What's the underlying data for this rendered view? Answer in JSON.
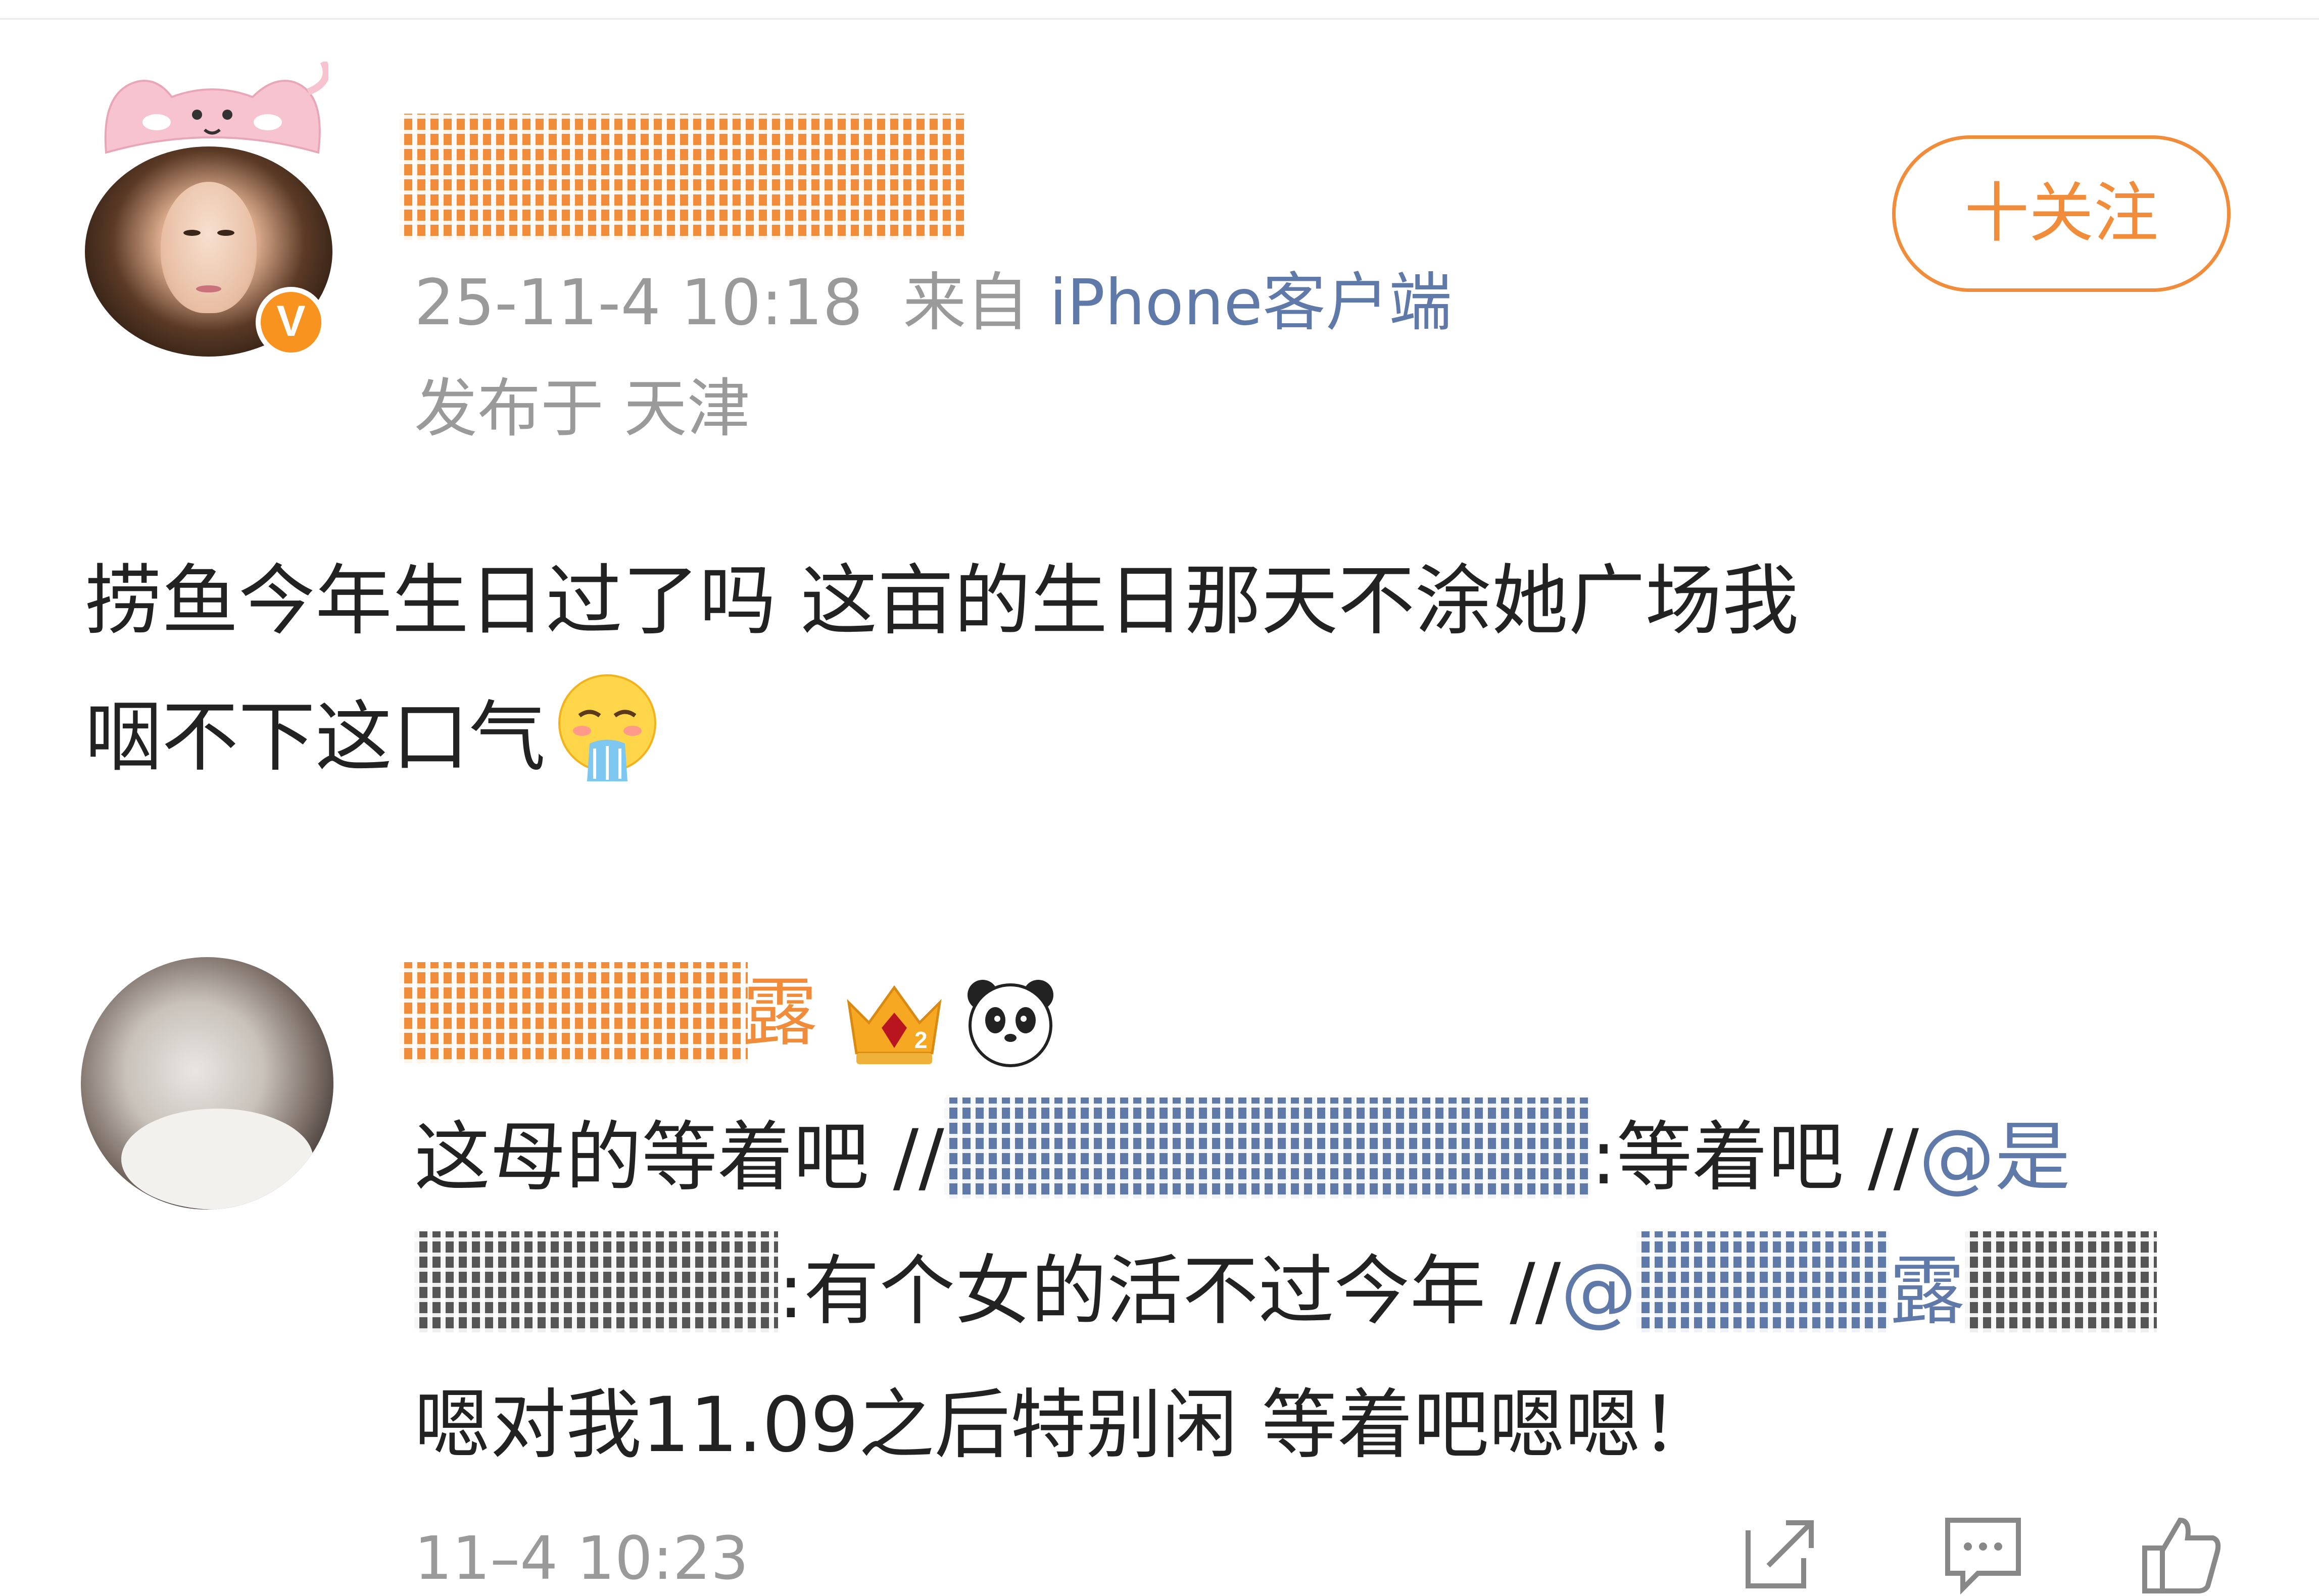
{
  "post": {
    "timestamp": "25-11-4 10:18",
    "source_prefix": "来自",
    "source": "iPhone客户端",
    "location": "发布于 天津",
    "follow_label": "十关注",
    "text_lines": [
      "捞鱼今年生日过了吗 这亩的生日那天不涂她广场我",
      "咽不下这口气"
    ],
    "verified_badge": "V",
    "emoji": "puking-face-icon"
  },
  "repost": {
    "name_visible": "露",
    "line1_a": "这母的等着吧 //",
    "line1_b": ":等着吧 //",
    "line1_c": "@是",
    "line2_b": ":有个女的活不过今年 //",
    "line2_c": "@",
    "line2_d": "露",
    "line3": "嗯对我11.09之后特别闲 等着吧嗯嗯！",
    "timestamp": "11–4 10:23"
  },
  "colors": {
    "accent_orange": "#f08c3a",
    "link_blue": "#5f79a8",
    "meta_gray": "#9a9a9a"
  },
  "icons": [
    "share-icon",
    "comment-icon",
    "like-icon",
    "crown-badge-icon",
    "panda-icon"
  ]
}
